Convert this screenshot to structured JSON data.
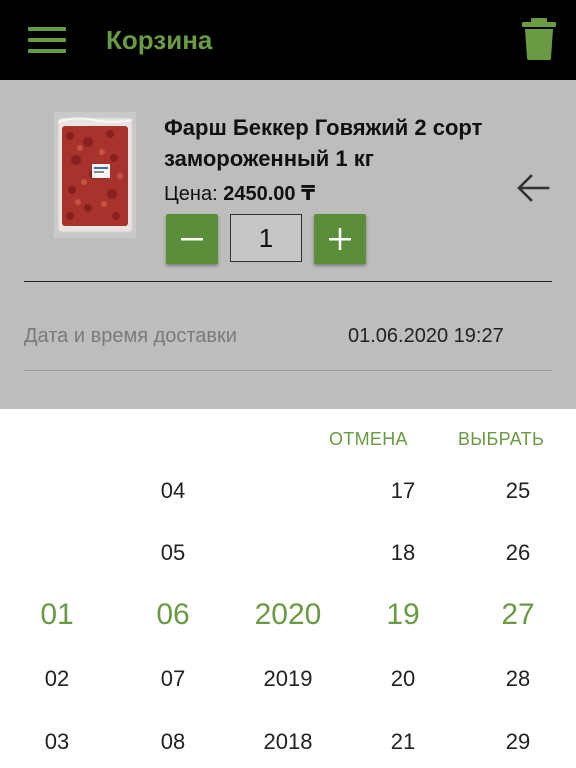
{
  "topbar": {
    "title": "Корзина",
    "menu_icon": "hamburger-menu-icon",
    "trash_icon": "trash-icon"
  },
  "product": {
    "name": "Фарш Беккер Говяжий 2 сорт замороженный 1 кг",
    "price_label": "Цена:",
    "price_value": "2450.00 ₸",
    "quantity": "1",
    "minus_icon": "minus-icon",
    "plus_icon": "plus-icon",
    "back_icon": "arrow-left-icon"
  },
  "delivery": {
    "label": "Дата и время доставки",
    "value": "01.06.2020 19:27"
  },
  "picker": {
    "cancel_label": "ОТМЕНА",
    "select_label": "ВЫБРАТЬ",
    "columns": {
      "day": [
        "",
        "",
        "01",
        "02",
        "03"
      ],
      "month": [
        "04",
        "05",
        "06",
        "07",
        "08"
      ],
      "year": [
        "",
        "",
        "2020",
        "2019",
        "2018"
      ],
      "hour": [
        "17",
        "18",
        "19",
        "20",
        "21"
      ],
      "minute": [
        "25",
        "26",
        "27",
        "28",
        "29"
      ]
    },
    "selected_index": 2
  },
  "colors": {
    "accent": "#6a9a43",
    "button": "#5b8e3b",
    "topbar": "#000000",
    "overlay": "#bdbdbd"
  }
}
